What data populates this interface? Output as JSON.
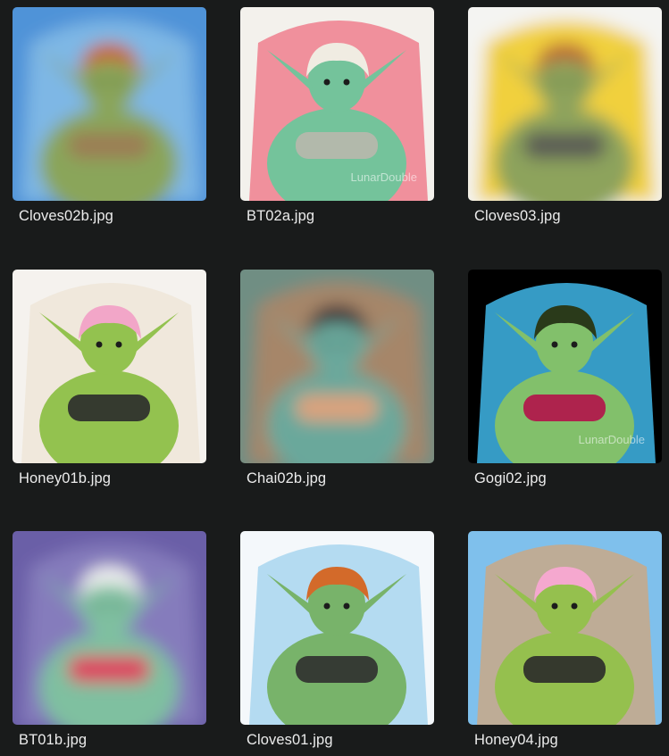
{
  "files": [
    {
      "name": "Cloves02b.jpg",
      "blurred": true,
      "colors": {
        "bg": "#4f93d8",
        "bg2": "#86bde8",
        "body": "#8aa55a",
        "hair": "#c8642a",
        "accent": "#9c7a54"
      }
    },
    {
      "name": "BT02a.jpg",
      "blurred": false,
      "watermark": "LunarDouble",
      "colors": {
        "bg": "#f3f1ec",
        "bg2": "#ef7f8e",
        "body": "#74c39b",
        "hair": "#f0ece2",
        "accent": "#b9b8ad"
      }
    },
    {
      "name": "Cloves03.jpg",
      "blurred": true,
      "colors": {
        "bg": "#f4f4f2",
        "bg2": "#f0c91f",
        "body": "#8da35c",
        "hair": "#bb6a34",
        "accent": "#555555"
      }
    },
    {
      "name": "Honey01b.jpg",
      "blurred": false,
      "colors": {
        "bg": "#f5f2ee",
        "bg2": "#efe6d8",
        "body": "#93c24f",
        "hair": "#f2a6c8",
        "accent": "#2b2b2b"
      }
    },
    {
      "name": "Chai02b.jpg",
      "blurred": true,
      "colors": {
        "bg": "#6f8e83",
        "bg2": "#b08565",
        "body": "#6aa89b",
        "hair": "#3a2e35",
        "accent": "#e7a27a"
      }
    },
    {
      "name": "Gogi02.jpg",
      "blurred": false,
      "watermark": "LunarDouble",
      "colors": {
        "bg": "#000000",
        "bg2": "#3fb6e7",
        "body": "#82c06b",
        "hair": "#2a3a1a",
        "accent": "#b3124a"
      }
    },
    {
      "name": "BT01b.jpg",
      "blurred": true,
      "colors": {
        "bg": "#6b5fa7",
        "bg2": "#8a80c0",
        "body": "#7fc0a0",
        "hair": "#f2f2f2",
        "accent": "#e8365a"
      }
    },
    {
      "name": "Cloves01.jpg",
      "blurred": false,
      "colors": {
        "bg": "#f4f8fb",
        "bg2": "#a8d6ef",
        "body": "#78b36a",
        "hair": "#d36a2a",
        "accent": "#2f2f2f"
      }
    },
    {
      "name": "Honey04.jpg",
      "blurred": false,
      "colors": {
        "bg": "#7fc0ec",
        "bg2": "#c9a887",
        "body": "#95c04e",
        "hair": "#f5a8cf",
        "accent": "#2a2a2a"
      }
    }
  ]
}
